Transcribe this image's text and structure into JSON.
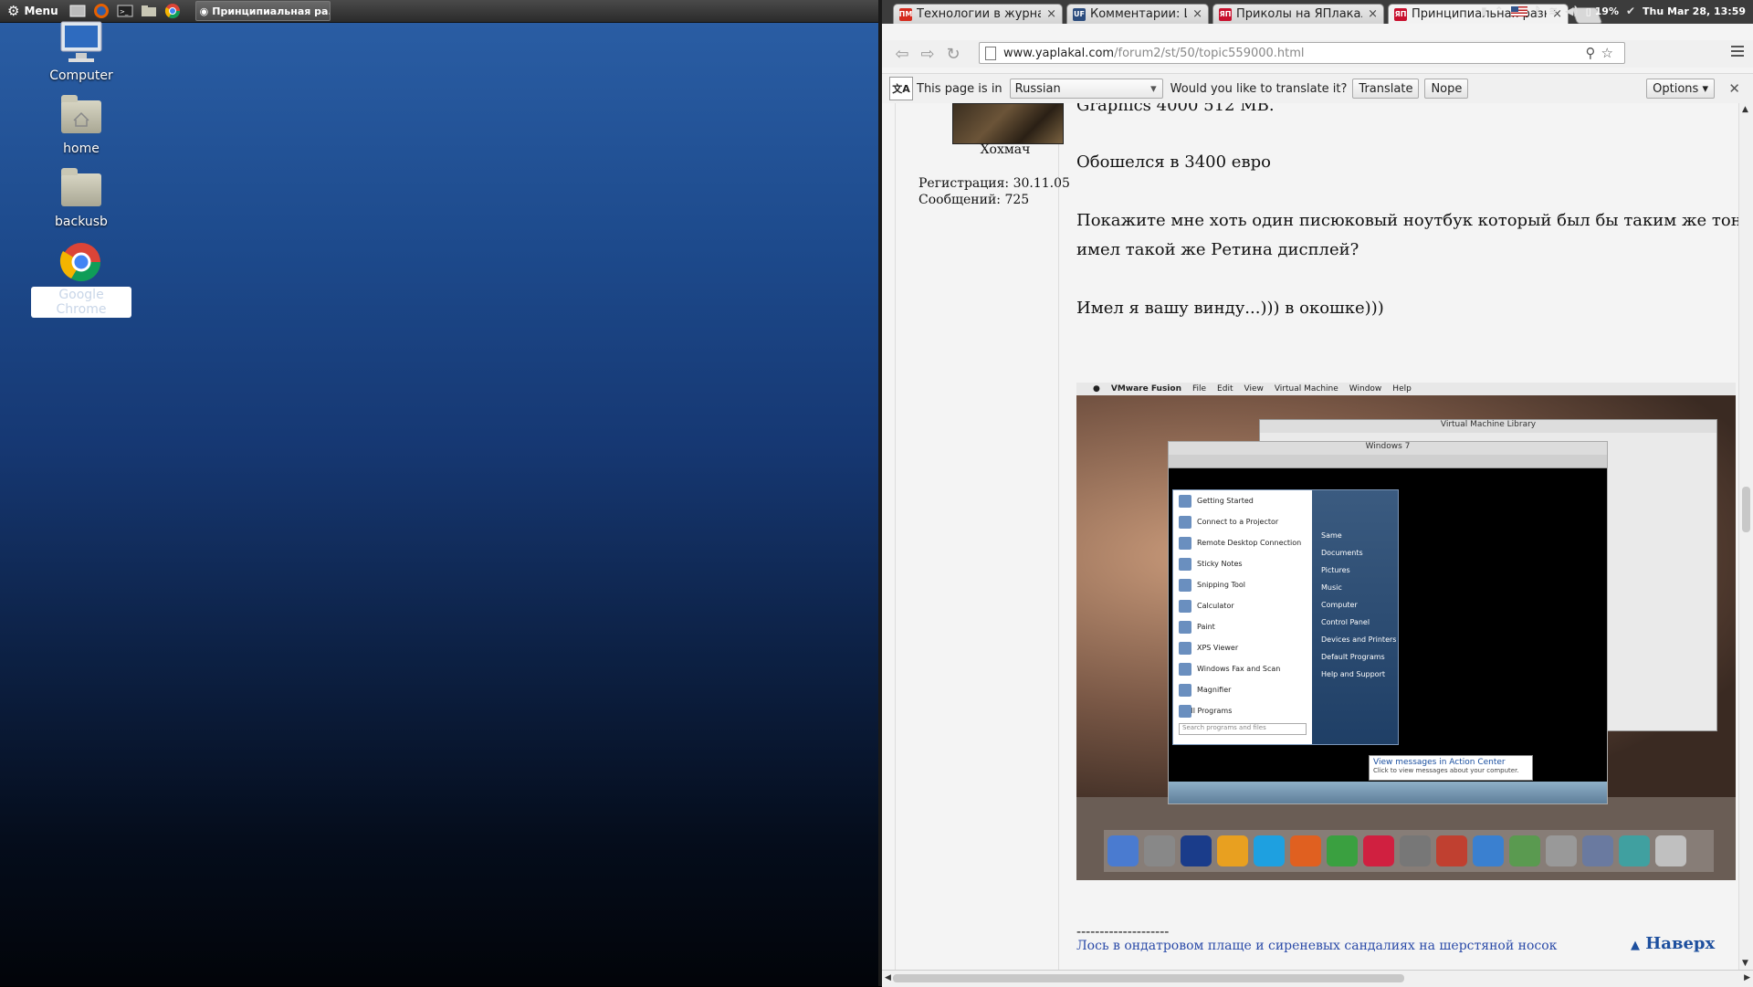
{
  "panel": {
    "menu_label": "Menu",
    "task_title": "Принципиальная ра..."
  },
  "desktop": {
    "icons": [
      {
        "label": "Computer"
      },
      {
        "label": "home"
      },
      {
        "label": "backusb"
      },
      {
        "label": "Google Chrome"
      }
    ]
  },
  "tray": {
    "battery": "19%",
    "clock": "Thu Mar 28, 13:59"
  },
  "tabs": [
    {
      "title": "Технологии в журнале",
      "favicon": "ПМ",
      "fav_color": "#d52b1e"
    },
    {
      "title": "Комментарии: Шинобу",
      "favicon": "UF",
      "fav_color": "#2b4c7e"
    },
    {
      "title": "Приколы на ЯПлакал",
      "favicon": "ЯП",
      "fav_color": "#c8102e"
    },
    {
      "title": "Принципиальная разн",
      "favicon": "ЯП",
      "fav_color": "#c8102e"
    }
  ],
  "url": {
    "host": "www.yaplakal.com",
    "path": "/forum2/st/50/topic559000.html"
  },
  "translate_bar": {
    "prefix": "This page is in",
    "language": "Russian",
    "question": "Would you like to translate it?",
    "translate": "Translate",
    "nope": "Nope",
    "options": "Options"
  },
  "author": {
    "name": "Хохмач",
    "registration": "Регистрация: 30.11.05",
    "messages": "Сообщений: 725"
  },
  "post": {
    "line0": "Graphics 4000 512 MB.",
    "line1": "Обошелся в 3400 евро",
    "line2": "Покажите мне хоть один писюковый ноутбук который был бы таким же тонким, весил",
    "line3": "имел такой же Ретина дисплей?",
    "line4": "Имел я вашу винду...))) в окошке)))"
  },
  "screenshot": {
    "app": "VMware Fusion",
    "menus": [
      "File",
      "Edit",
      "View",
      "Virtual Machine",
      "Window",
      "Help"
    ],
    "library_title": "Virtual Machine Library",
    "vm_title": "Windows 7",
    "start_left": [
      "Getting Started",
      "Connect to a Projector",
      "Remote Desktop Connection",
      "Sticky Notes",
      "Snipping Tool",
      "Calculator",
      "Paint",
      "XPS Viewer",
      "Windows Fax and Scan",
      "Magnifier",
      "All Programs"
    ],
    "start_right": [
      "Same",
      "Documents",
      "Pictures",
      "Music",
      "Computer",
      "Control Panel",
      "Devices and Printers",
      "Default Programs",
      "Help and Support"
    ],
    "search_placeholder": "Search programs and files",
    "balloon_title": "View messages in Action Center",
    "balloon_text": "Click to view messages about your computer."
  },
  "signature": {
    "dashes": "--------------------",
    "text": "Лось в ондатровом плаще и сиреневых сандалиях на шерстяной носок"
  },
  "to_top": "Наверх"
}
